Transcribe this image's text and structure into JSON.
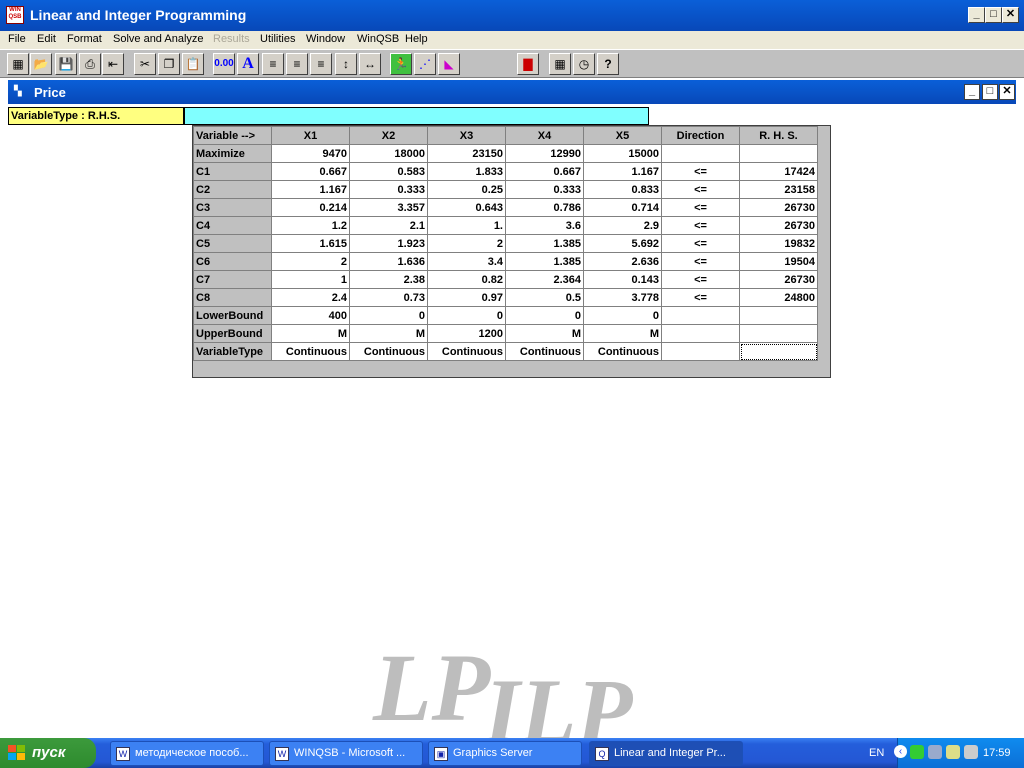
{
  "app": {
    "title": "Linear and Integer Programming",
    "icon_text": "WIN QSB"
  },
  "menu": [
    {
      "label": "File",
      "disabled": false
    },
    {
      "label": "Edit",
      "disabled": false
    },
    {
      "label": "Format",
      "disabled": false
    },
    {
      "label": "Solve and Analyze",
      "disabled": false
    },
    {
      "label": "Results",
      "disabled": true
    },
    {
      "label": "Utilities",
      "disabled": false
    },
    {
      "label": "Window",
      "disabled": false
    },
    {
      "label": "WinQSB",
      "disabled": false
    },
    {
      "label": "Help",
      "disabled": false
    }
  ],
  "toolbar": {
    "number_format_label": "0.00",
    "font_label": "A"
  },
  "child_window": {
    "title": "Price"
  },
  "cell_editor": {
    "label": "VariableType : R.H.S.",
    "value": ""
  },
  "grid": {
    "corner": "Variable -->",
    "columns": [
      "X1",
      "X2",
      "X3",
      "X4",
      "X5",
      "Direction",
      "R. H. S."
    ],
    "rows": [
      {
        "label": "Maximize",
        "cells": [
          "9470",
          "18000",
          "23150",
          "12990",
          "15000",
          "",
          ""
        ]
      },
      {
        "label": "C1",
        "cells": [
          "0.667",
          "0.583",
          "1.833",
          "0.667",
          "1.167",
          "<=",
          "17424"
        ]
      },
      {
        "label": "C2",
        "cells": [
          "1.167",
          "0.333",
          "0.25",
          "0.333",
          "0.833",
          "<=",
          "23158"
        ]
      },
      {
        "label": "C3",
        "cells": [
          "0.214",
          "3.357",
          "0.643",
          "0.786",
          "0.714",
          "<=",
          "26730"
        ]
      },
      {
        "label": "C4",
        "cells": [
          "1.2",
          "2.1",
          "1.",
          "3.6",
          "2.9",
          "<=",
          "26730"
        ]
      },
      {
        "label": "C5",
        "cells": [
          "1.615",
          "1.923",
          "2",
          "1.385",
          "5.692",
          "<=",
          "19832"
        ]
      },
      {
        "label": "C6",
        "cells": [
          "2",
          "1.636",
          "3.4",
          "1.385",
          "2.636",
          "<=",
          "19504"
        ]
      },
      {
        "label": "C7",
        "cells": [
          "1",
          "2.38",
          "0.82",
          "2.364",
          "0.143",
          "<=",
          "26730"
        ]
      },
      {
        "label": "C8",
        "cells": [
          "2.4",
          "0.73",
          "0.97",
          "0.5",
          "3.778",
          "<=",
          "24800"
        ]
      },
      {
        "label": "LowerBound",
        "cells": [
          "400",
          "0",
          "0",
          "0",
          "0",
          "",
          ""
        ]
      },
      {
        "label": "UpperBound",
        "cells": [
          "M",
          "M",
          "1200",
          "M",
          "M",
          "",
          ""
        ]
      },
      {
        "label": "VariableType",
        "cells": [
          "Continuous",
          "Continuous",
          "Continuous",
          "Continuous",
          "Continuous",
          "",
          ""
        ]
      }
    ]
  },
  "watermark": {
    "part1": "LP",
    "part2": "ILP"
  },
  "taskbar": {
    "start_label": "пуск",
    "tasks": [
      {
        "label": "методическое пособ...",
        "icon": "word-icon",
        "active": false
      },
      {
        "label": "WINQSB - Microsoft ...",
        "icon": "word-icon",
        "active": false
      },
      {
        "label": "Graphics Server",
        "icon": "graphics-server-icon",
        "active": false
      },
      {
        "label": "Linear and Integer Pr...",
        "icon": "winqsb-icon",
        "active": true
      }
    ],
    "language": "EN",
    "clock": "17:59"
  }
}
